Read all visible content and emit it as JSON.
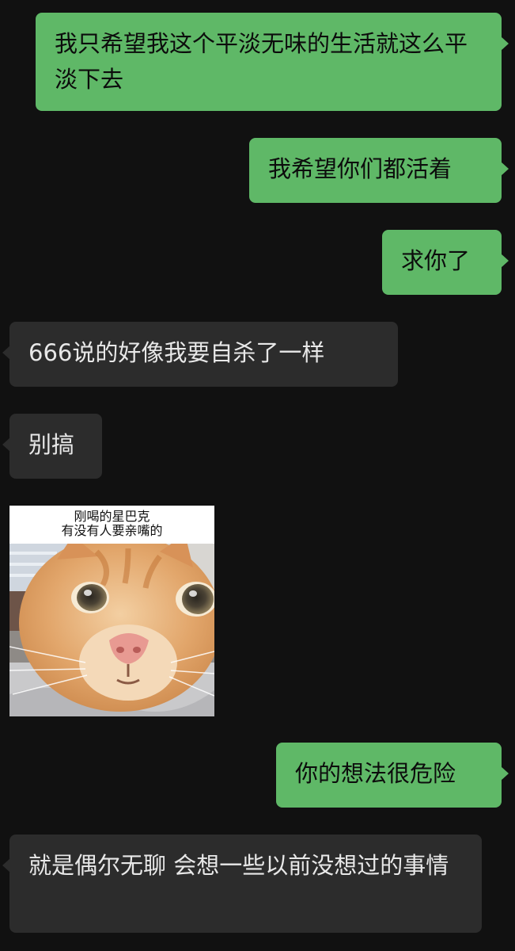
{
  "chat": {
    "messages": [
      {
        "direction": "outgoing",
        "text": "我只希望我这个平淡无味的生活就这么平淡下去"
      },
      {
        "direction": "outgoing",
        "text": "我希望你们都活着"
      },
      {
        "direction": "outgoing",
        "text": "求你了"
      },
      {
        "direction": "incoming",
        "text": "666说的好像我要自杀了一样"
      },
      {
        "direction": "incoming",
        "text": "别搞"
      },
      {
        "direction": "incoming",
        "type": "sticker",
        "caption_line1": "刚喝的星巴克",
        "caption_line2": "有没有人要亲嘴的",
        "image": "orange-cat-closeup"
      },
      {
        "direction": "outgoing",
        "text": "你的想法很危险"
      },
      {
        "direction": "incoming",
        "text": "就是偶尔无聊 会想一些以前没想过的事情"
      }
    ]
  },
  "colors": {
    "background": "#111111",
    "outgoing_bubble": "#5fb867",
    "incoming_bubble": "#2c2c2c"
  }
}
